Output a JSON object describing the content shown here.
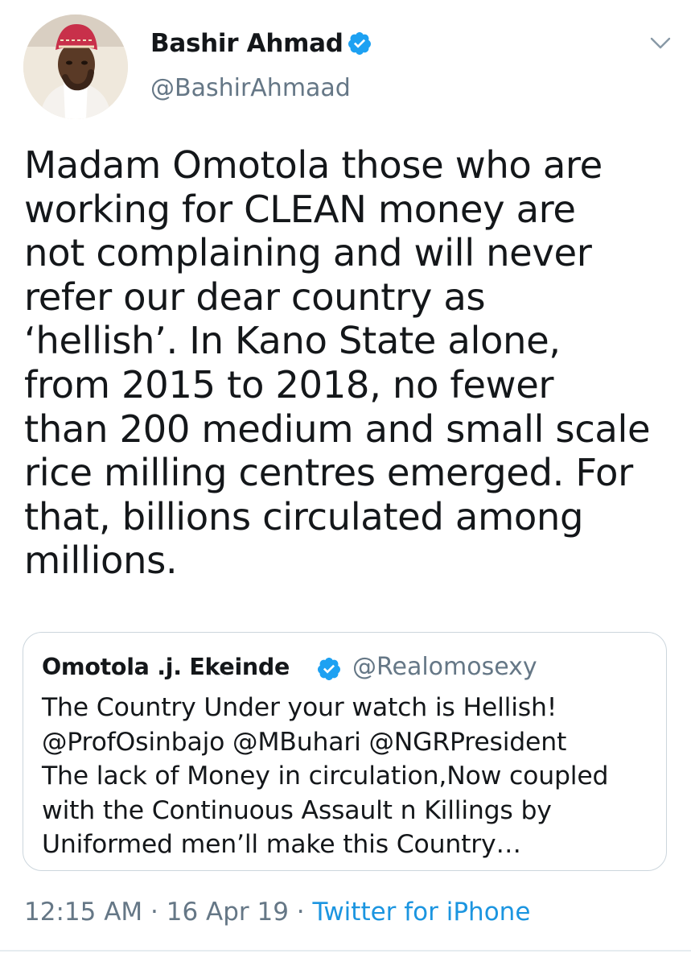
{
  "author": {
    "display_name": "Bashir Ahmad",
    "handle": "@BashirAhmaad",
    "verified": true
  },
  "tweet": {
    "lines": [
      "Madam Omotola those who are",
      "working for CLEAN money are",
      "not complaining and will never",
      "refer our dear country as",
      "‘hellish’. In Kano State alone,",
      "from 2015 to 2018, no fewer",
      "than 200 medium and small scale",
      "rice milling centres emerged. For",
      "that, billions circulated among",
      "millions."
    ]
  },
  "quoted_tweet": {
    "display_name": "Omotola .j. Ekeinde",
    "handle": "@Realomosexy",
    "verified": true,
    "lines": [
      "The Country Under your watch is Hellish!",
      "@ProfOsinbajo @MBuhari @NGRPresident",
      "The lack of Money in circulation,Now coupled",
      "with the Continuous Assault n Killings by",
      "Uniformed men’ll make this Country…"
    ]
  },
  "meta": {
    "time": "12:15 AM",
    "separator": " · ",
    "date": "16 Apr 19",
    "source": "Twitter for iPhone"
  },
  "icons": {
    "verified": "verified-badge-icon",
    "menu": "chevron-down-icon"
  },
  "colors": {
    "verified_blue": "#1da1f2",
    "link_blue": "#1b95e0",
    "secondary_text": "#657786",
    "border": "#ccd6dd"
  }
}
